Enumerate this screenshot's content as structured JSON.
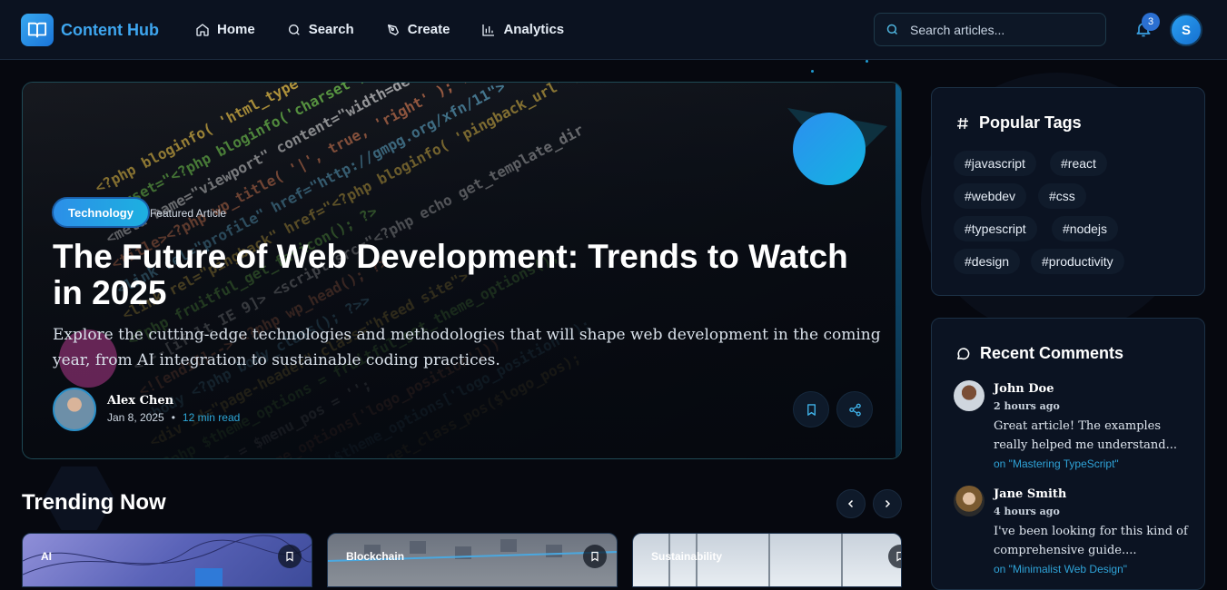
{
  "app": {
    "name": "Content Hub"
  },
  "nav": [
    {
      "label": "Home",
      "icon": "home-icon"
    },
    {
      "label": "Search",
      "icon": "search-icon"
    },
    {
      "label": "Create",
      "icon": "pen-icon"
    },
    {
      "label": "Analytics",
      "icon": "bar-chart-icon"
    }
  ],
  "search": {
    "placeholder": "Search articles..."
  },
  "notifications": {
    "count": "3"
  },
  "user": {
    "initial": "S"
  },
  "hero": {
    "category": "Technology",
    "featured_label": "Featured Article",
    "title": "The Future of Web Development: Trends to Watch in 2025",
    "description": "Explore the cutting-edge technologies and methodologies that will shape web development in the coming year, from AI integration to sustainable coding practices.",
    "author": "Alex Chen",
    "date": "Jan 8, 2025",
    "read_time": "12 min read",
    "code_lines": [
      "<?php bloginfo( 'html_type' ); ?>; charset=",
      "charset=\"<?php bloginfo('charset'); ?>\" />",
      "<meta name=\"viewport\" content=\"width=device-width\">",
      "<title><?php wp_title( '|', true, 'right' ); ?>",
      "<link rel=\"profile\" href=\"http://gmpg.org/xfn/11\">",
      "<link rel=\"pingback\" href=\"<?php bloginfo( 'pingback_url' ); ?>\">",
      "<?php fruitful_get_favicon(); ?>",
      "<!--[if lt IE 9]> <script src=\"<?php echo get_template_dir",
      "<![endif]--> <?php wp_head(); ?>",
      "<body <?php body_class(); ?>>",
      "<div id=\"page-header\" class=\"hfeed site\">",
      "<?php $theme_options = fruitful_get_theme_options();",
      "$logo_pos = $menu_pos = '';",
      "if (isset($theme_options['logo_position']))",
      "$logo_pos = esc_attr($theme_options['logo_position']);",
      "$logo_pos_class = fruitful_get_class_pos($logo_pos);"
    ]
  },
  "trending": {
    "title": "Trending Now",
    "cards": [
      {
        "tag": "AI"
      },
      {
        "tag": "Blockchain"
      },
      {
        "tag": "Sustainability"
      }
    ]
  },
  "popular_tags": {
    "title": "Popular Tags",
    "tags": [
      "#javascript",
      "#react",
      "#webdev",
      "#css",
      "#typescript",
      "#nodejs",
      "#design",
      "#productivity"
    ]
  },
  "recent_comments": {
    "title": "Recent Comments",
    "items": [
      {
        "name": "John Doe",
        "time": "2 hours ago",
        "text": "Great article! The examples really helped me understand...",
        "on": "on \"Mastering TypeScript\""
      },
      {
        "name": "Jane Smith",
        "time": "4 hours ago",
        "text": "I've been looking for this kind of comprehensive guide....",
        "on": "on \"Minimalist Web Design\""
      }
    ]
  },
  "colors": {
    "accent": "#3ea6ef",
    "link": "#2fa3d8",
    "background": "#06080f",
    "panel": "#0b1322"
  }
}
